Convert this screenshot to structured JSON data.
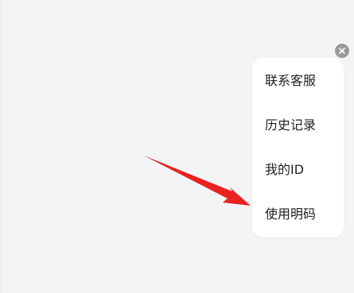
{
  "menu": {
    "items": [
      {
        "label": "联系客服"
      },
      {
        "label": "历史记录"
      },
      {
        "label": "我的ID"
      },
      {
        "label": "使用明码"
      }
    ]
  },
  "icons": {
    "close": "close-icon",
    "annotation": "red-arrow-icon"
  },
  "colors": {
    "background": "#f3f4f6",
    "menu_background": "#ffffff",
    "close_button": "#9a9a9a",
    "arrow": "#e8221e"
  }
}
